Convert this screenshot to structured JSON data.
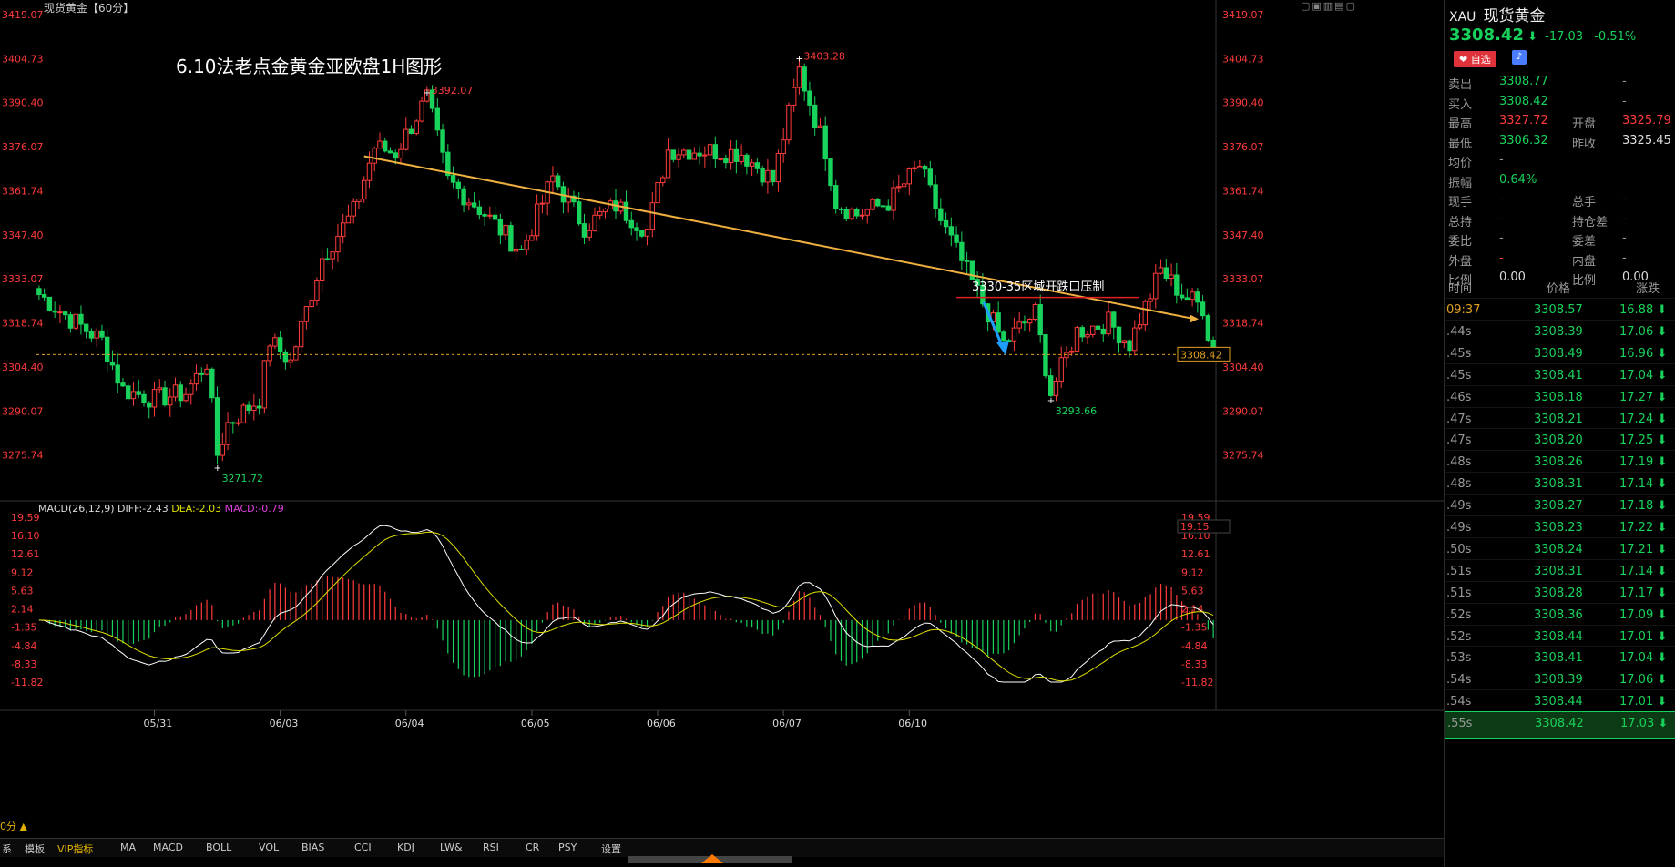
{
  "chart_title": "现货黄金【60分】",
  "annotation_title": "6.10法老点金黄金亚欧盘1H图形",
  "annotation_resistance": "3330-35区域开跌口压制",
  "price_labels": {
    "high1": "3392.07",
    "high2": "3403.28",
    "low1": "3271.72",
    "low2": "3293.66",
    "current": "3308.42"
  },
  "colors": {
    "up": "#ff3b3b",
    "down": "#18d35b",
    "trend": "#f0b040",
    "hline": "#e02020",
    "arrow": "#1e9fff",
    "dif": "#ffffff",
    "dea": "#e0e000"
  },
  "price_axis": {
    "min": 3261.41,
    "max": 3419.07,
    "ticks": [
      "3419.07",
      "3404.73",
      "3390.40",
      "3376.07",
      "3361.74",
      "3347.40",
      "3333.07",
      "3318.74",
      "3304.40",
      "3290.07",
      "3275.74"
    ]
  },
  "macd": {
    "label": "MACD(26,12,9)",
    "diff_label": "DIFF:-2.43",
    "dea_label": "DEA:-2.03",
    "macd_label": "MACD:-0.79",
    "ticks": [
      "19.59",
      "16.10",
      "12.61",
      "9.12",
      "5.63",
      "2.14",
      "-1.35",
      "-4.84",
      "-8.33",
      "-11.82"
    ],
    "right_value": "19.15"
  },
  "date_ticks": [
    "05/31",
    "06/03",
    "06/04",
    "06/05",
    "06/06",
    "06/07",
    "06/10"
  ],
  "toolbar": {
    "left_label": "0分 ▲",
    "items": [
      "系",
      "模板",
      "VIP指标",
      "MA",
      "MACD",
      "BOLL",
      "VOL",
      "BIAS",
      "CCI",
      "KDJ",
      "LW&",
      "RSI",
      "CR",
      "PSY",
      "设置"
    ]
  },
  "chart_data": {
    "type": "candlestick",
    "title": "6.10法老点金黄金亚欧盘1H图形",
    "ylim": [
      3261.41,
      3419.07
    ],
    "anchors": [
      {
        "x": 0,
        "y": 3328
      },
      {
        "x": 6,
        "y": 3320
      },
      {
        "x": 12,
        "y": 3313
      },
      {
        "x": 16,
        "y": 3297
      },
      {
        "x": 22,
        "y": 3294
      },
      {
        "x": 28,
        "y": 3296
      },
      {
        "x": 32,
        "y": 3306
      },
      {
        "x": 34,
        "y": 3276
      },
      {
        "x": 36,
        "y": 3286
      },
      {
        "x": 42,
        "y": 3294
      },
      {
        "x": 44,
        "y": 3313
      },
      {
        "x": 48,
        "y": 3306
      },
      {
        "x": 54,
        "y": 3340
      },
      {
        "x": 60,
        "y": 3355
      },
      {
        "x": 64,
        "y": 3376
      },
      {
        "x": 68,
        "y": 3374
      },
      {
        "x": 74,
        "y": 3392
      },
      {
        "x": 78,
        "y": 3365
      },
      {
        "x": 84,
        "y": 3356
      },
      {
        "x": 92,
        "y": 3342
      },
      {
        "x": 98,
        "y": 3366
      },
      {
        "x": 104,
        "y": 3350
      },
      {
        "x": 110,
        "y": 3357
      },
      {
        "x": 116,
        "y": 3349
      },
      {
        "x": 120,
        "y": 3375
      },
      {
        "x": 126,
        "y": 3375
      },
      {
        "x": 134,
        "y": 3374
      },
      {
        "x": 140,
        "y": 3365
      },
      {
        "x": 145,
        "y": 3401
      },
      {
        "x": 150,
        "y": 3375
      },
      {
        "x": 152,
        "y": 3358
      },
      {
        "x": 156,
        "y": 3354
      },
      {
        "x": 162,
        "y": 3358
      },
      {
        "x": 168,
        "y": 3370
      },
      {
        "x": 172,
        "y": 3352
      },
      {
        "x": 178,
        "y": 3332
      },
      {
        "x": 184,
        "y": 3312
      },
      {
        "x": 190,
        "y": 3322
      },
      {
        "x": 193,
        "y": 3296
      },
      {
        "x": 198,
        "y": 3316
      },
      {
        "x": 204,
        "y": 3319
      },
      {
        "x": 208,
        "y": 3312
      },
      {
        "x": 214,
        "y": 3336
      },
      {
        "x": 218,
        "y": 3328
      },
      {
        "x": 222,
        "y": 3324
      },
      {
        "x": 224,
        "y": 3307
      }
    ],
    "candle_count": 225,
    "series": [
      {
        "name": "DIFF:-2.43"
      },
      {
        "name": "DEA:-2.03"
      },
      {
        "name": "MACD:-0.79"
      }
    ],
    "hline": 3327,
    "current": 3308.42,
    "labels": [
      {
        "text": "3392.07",
        "x": 74,
        "y": 3392.07
      },
      {
        "text": "3403.28",
        "x": 145,
        "y": 3403.28
      },
      {
        "text": "3271.72",
        "x": 34,
        "y": 3271.72
      },
      {
        "text": "3293.66",
        "x": 193,
        "y": 3293.66
      }
    ]
  },
  "panel": {
    "symbol": "XAU",
    "name": "现货黄金",
    "price": "3308.42",
    "arrow": "⬇",
    "change": "-17.03",
    "change_pct": "-0.51%",
    "fav": "❤ 自选",
    "rows": [
      {
        "l1": "卖出",
        "v1": "3308.77",
        "l2": "",
        "v2": "-",
        "c1": "green"
      },
      {
        "l1": "买入",
        "v1": "3308.42",
        "l2": "",
        "v2": "-",
        "c1": "green"
      },
      {
        "l1": "最高",
        "v1": "3327.72",
        "l2": "开盘",
        "v2": "3325.79",
        "c1": "red",
        "c2": "red"
      },
      {
        "l1": "最低",
        "v1": "3306.32",
        "l2": "昨收",
        "v2": "3325.45",
        "c1": "green",
        "c2": "white"
      },
      {
        "l1": "均价",
        "v1": "-",
        "l2": "",
        "v2": ""
      },
      {
        "l1": "振幅",
        "v1": "0.64%",
        "l2": "",
        "v2": "",
        "c1": "green"
      },
      {
        "l1": "现手",
        "v1": "-",
        "l2": "总手",
        "v2": "-"
      },
      {
        "l1": "总持",
        "v1": "-",
        "l2": "持仓差",
        "v2": "-"
      },
      {
        "l1": "委比",
        "v1": "-",
        "l2": "委差",
        "v2": "-"
      },
      {
        "l1": "外盘",
        "v1": "-",
        "l2": "内盘",
        "v2": "-",
        "c1": "red"
      },
      {
        "l1": "比例",
        "v1": "0.00",
        "l2": "比例",
        "v2": "0.00",
        "c1": "white",
        "c2": "white"
      }
    ],
    "tick_headers": [
      "时间",
      "价格",
      "涨跌"
    ],
    "ticks": [
      {
        "t": "09:37",
        "p": "3308.57",
        "c": "16.88",
        "a": "⬇"
      },
      {
        "t": ".44s",
        "p": "3308.39",
        "c": "17.06",
        "a": "⬇"
      },
      {
        "t": ".45s",
        "p": "3308.49",
        "c": "16.96",
        "a": "⬇"
      },
      {
        "t": ".45s",
        "p": "3308.41",
        "c": "17.04",
        "a": "⬇"
      },
      {
        "t": ".46s",
        "p": "3308.18",
        "c": "17.27",
        "a": "⬇"
      },
      {
        "t": ".47s",
        "p": "3308.21",
        "c": "17.24",
        "a": "⬇"
      },
      {
        "t": ".47s",
        "p": "3308.20",
        "c": "17.25",
        "a": "⬇"
      },
      {
        "t": ".48s",
        "p": "3308.26",
        "c": "17.19",
        "a": "⬇"
      },
      {
        "t": ".48s",
        "p": "3308.31",
        "c": "17.14",
        "a": "⬇"
      },
      {
        "t": ".49s",
        "p": "3308.27",
        "c": "17.18",
        "a": "⬇"
      },
      {
        "t": ".49s",
        "p": "3308.23",
        "c": "17.22",
        "a": "⬇"
      },
      {
        "t": ".50s",
        "p": "3308.24",
        "c": "17.21",
        "a": "⬇"
      },
      {
        "t": ".51s",
        "p": "3308.31",
        "c": "17.14",
        "a": "⬇"
      },
      {
        "t": ".51s",
        "p": "3308.28",
        "c": "17.17",
        "a": "⬇"
      },
      {
        "t": ".52s",
        "p": "3308.36",
        "c": "17.09",
        "a": "⬇"
      },
      {
        "t": ".52s",
        "p": "3308.44",
        "c": "17.01",
        "a": "⬇"
      },
      {
        "t": ".53s",
        "p": "3308.41",
        "c": "17.04",
        "a": "⬇"
      },
      {
        "t": ".54s",
        "p": "3308.39",
        "c": "17.06",
        "a": "⬇"
      },
      {
        "t": ".54s",
        "p": "3308.44",
        "c": "17.01",
        "a": "⬇"
      },
      {
        "t": ".55s",
        "p": "3308.42",
        "c": "17.03",
        "a": "⬇"
      }
    ]
  }
}
